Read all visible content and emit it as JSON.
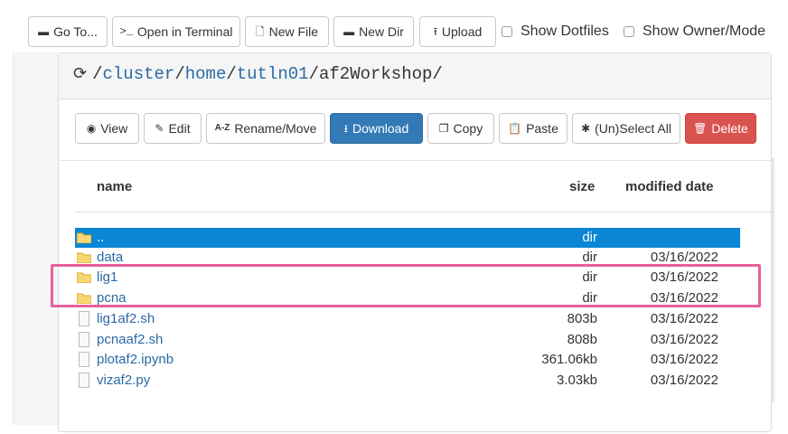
{
  "toolbar": {
    "goto": "Go To...",
    "terminal": "Open in Terminal",
    "newfile": "New File",
    "newdir": "New Dir",
    "upload": "Upload",
    "show_dotfiles": "Show Dotfiles",
    "show_owner": "Show Owner/Mode"
  },
  "path": {
    "segments": [
      "cluster",
      "home",
      "tutln01"
    ],
    "current": "af2Workshop"
  },
  "actions": {
    "view": "View",
    "edit": "Edit",
    "rename_icon": "A-Z",
    "rename": "Rename/Move",
    "download": "Download",
    "copy": "Copy",
    "paste": "Paste",
    "select_all": "(Un)Select All",
    "delete": "Delete"
  },
  "table": {
    "headers": {
      "name": "name",
      "size": "size",
      "date": "modified date"
    },
    "rows": [
      {
        "type": "folder",
        "name": "..",
        "size": "dir",
        "date": "",
        "selected": true
      },
      {
        "type": "folder",
        "name": "data",
        "size": "dir",
        "date": "03/16/2022"
      },
      {
        "type": "folder",
        "name": "lig1",
        "size": "dir",
        "date": "03/16/2022"
      },
      {
        "type": "folder",
        "name": "pcna",
        "size": "dir",
        "date": "03/16/2022"
      },
      {
        "type": "file",
        "name": "lig1af2.sh",
        "size": "803b",
        "date": "03/16/2022"
      },
      {
        "type": "file",
        "name": "pcnaaf2.sh",
        "size": "808b",
        "date": "03/16/2022"
      },
      {
        "type": "file",
        "name": "plotaf2.ipynb",
        "size": "361.06kb",
        "date": "03/16/2022"
      },
      {
        "type": "file",
        "name": "vizaf2.py",
        "size": "3.03kb",
        "date": "03/16/2022"
      }
    ]
  },
  "colors": {
    "link": "#2c6aa5",
    "primary": "#337ab7",
    "danger": "#d9534f",
    "selected_row": "#0a86d4",
    "highlight": "#e6609c",
    "folder": "#f0c44c"
  },
  "icons": {
    "goto": "folder-icon",
    "terminal": "terminal-icon",
    "newfile": "new-file-icon",
    "newdir": "folder-icon",
    "upload": "upload-icon",
    "refresh": "refresh-icon",
    "view": "eye-icon",
    "edit": "edit-icon",
    "download": "download-icon",
    "copy": "copy-icon",
    "paste": "paste-icon",
    "select_all": "asterisk-icon",
    "delete": "trash-icon"
  }
}
